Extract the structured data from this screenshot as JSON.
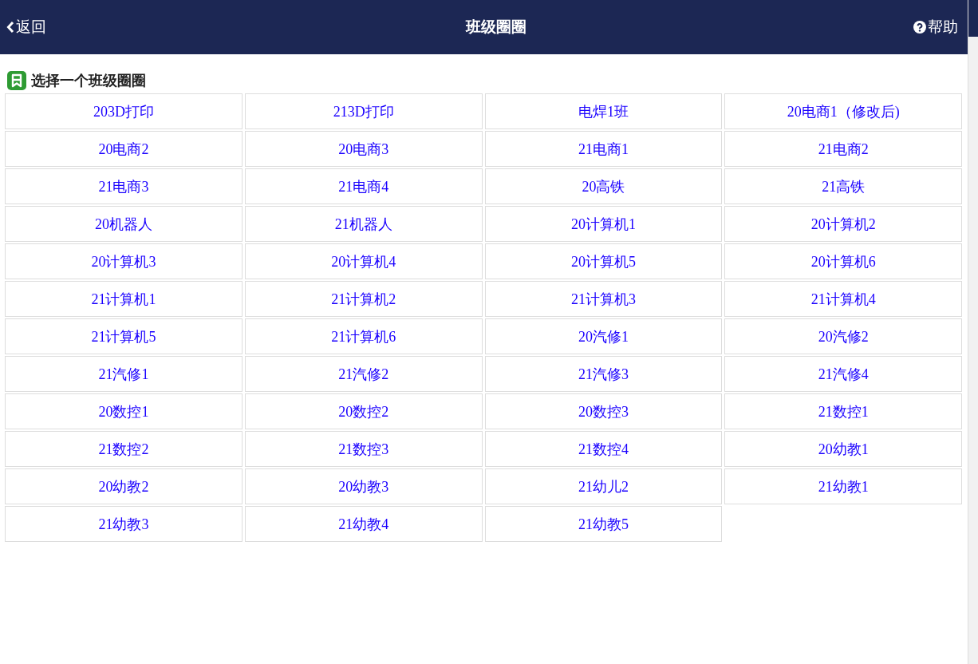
{
  "header": {
    "back": "返回",
    "title": "班级圈圈",
    "help": "帮助"
  },
  "section": {
    "heading": "选择一个班级圈圈"
  },
  "classes": [
    "203D打印",
    "213D打印",
    "电焊1班",
    "20电商1（修改后)",
    "20电商2",
    "20电商3",
    "21电商1",
    "21电商2",
    "21电商3",
    "21电商4",
    "20高铁",
    "21高铁",
    "20机器人",
    "21机器人",
    "20计算机1",
    "20计算机2",
    "20计算机3",
    "20计算机4",
    "20计算机5",
    "20计算机6",
    "21计算机1",
    "21计算机2",
    "21计算机3",
    "21计算机4",
    "21计算机5",
    "21计算机6",
    "20汽修1",
    "20汽修2",
    "21汽修1",
    "21汽修2",
    "21汽修3",
    "21汽修4",
    "20数控1",
    "20数控2",
    "20数控3",
    "21数控1",
    "21数控2",
    "21数控3",
    "21数控4",
    "20幼教1",
    "20幼教2",
    "20幼教3",
    "21幼儿2",
    "21幼教1",
    "21幼教3",
    "21幼教4",
    "21幼教5"
  ]
}
